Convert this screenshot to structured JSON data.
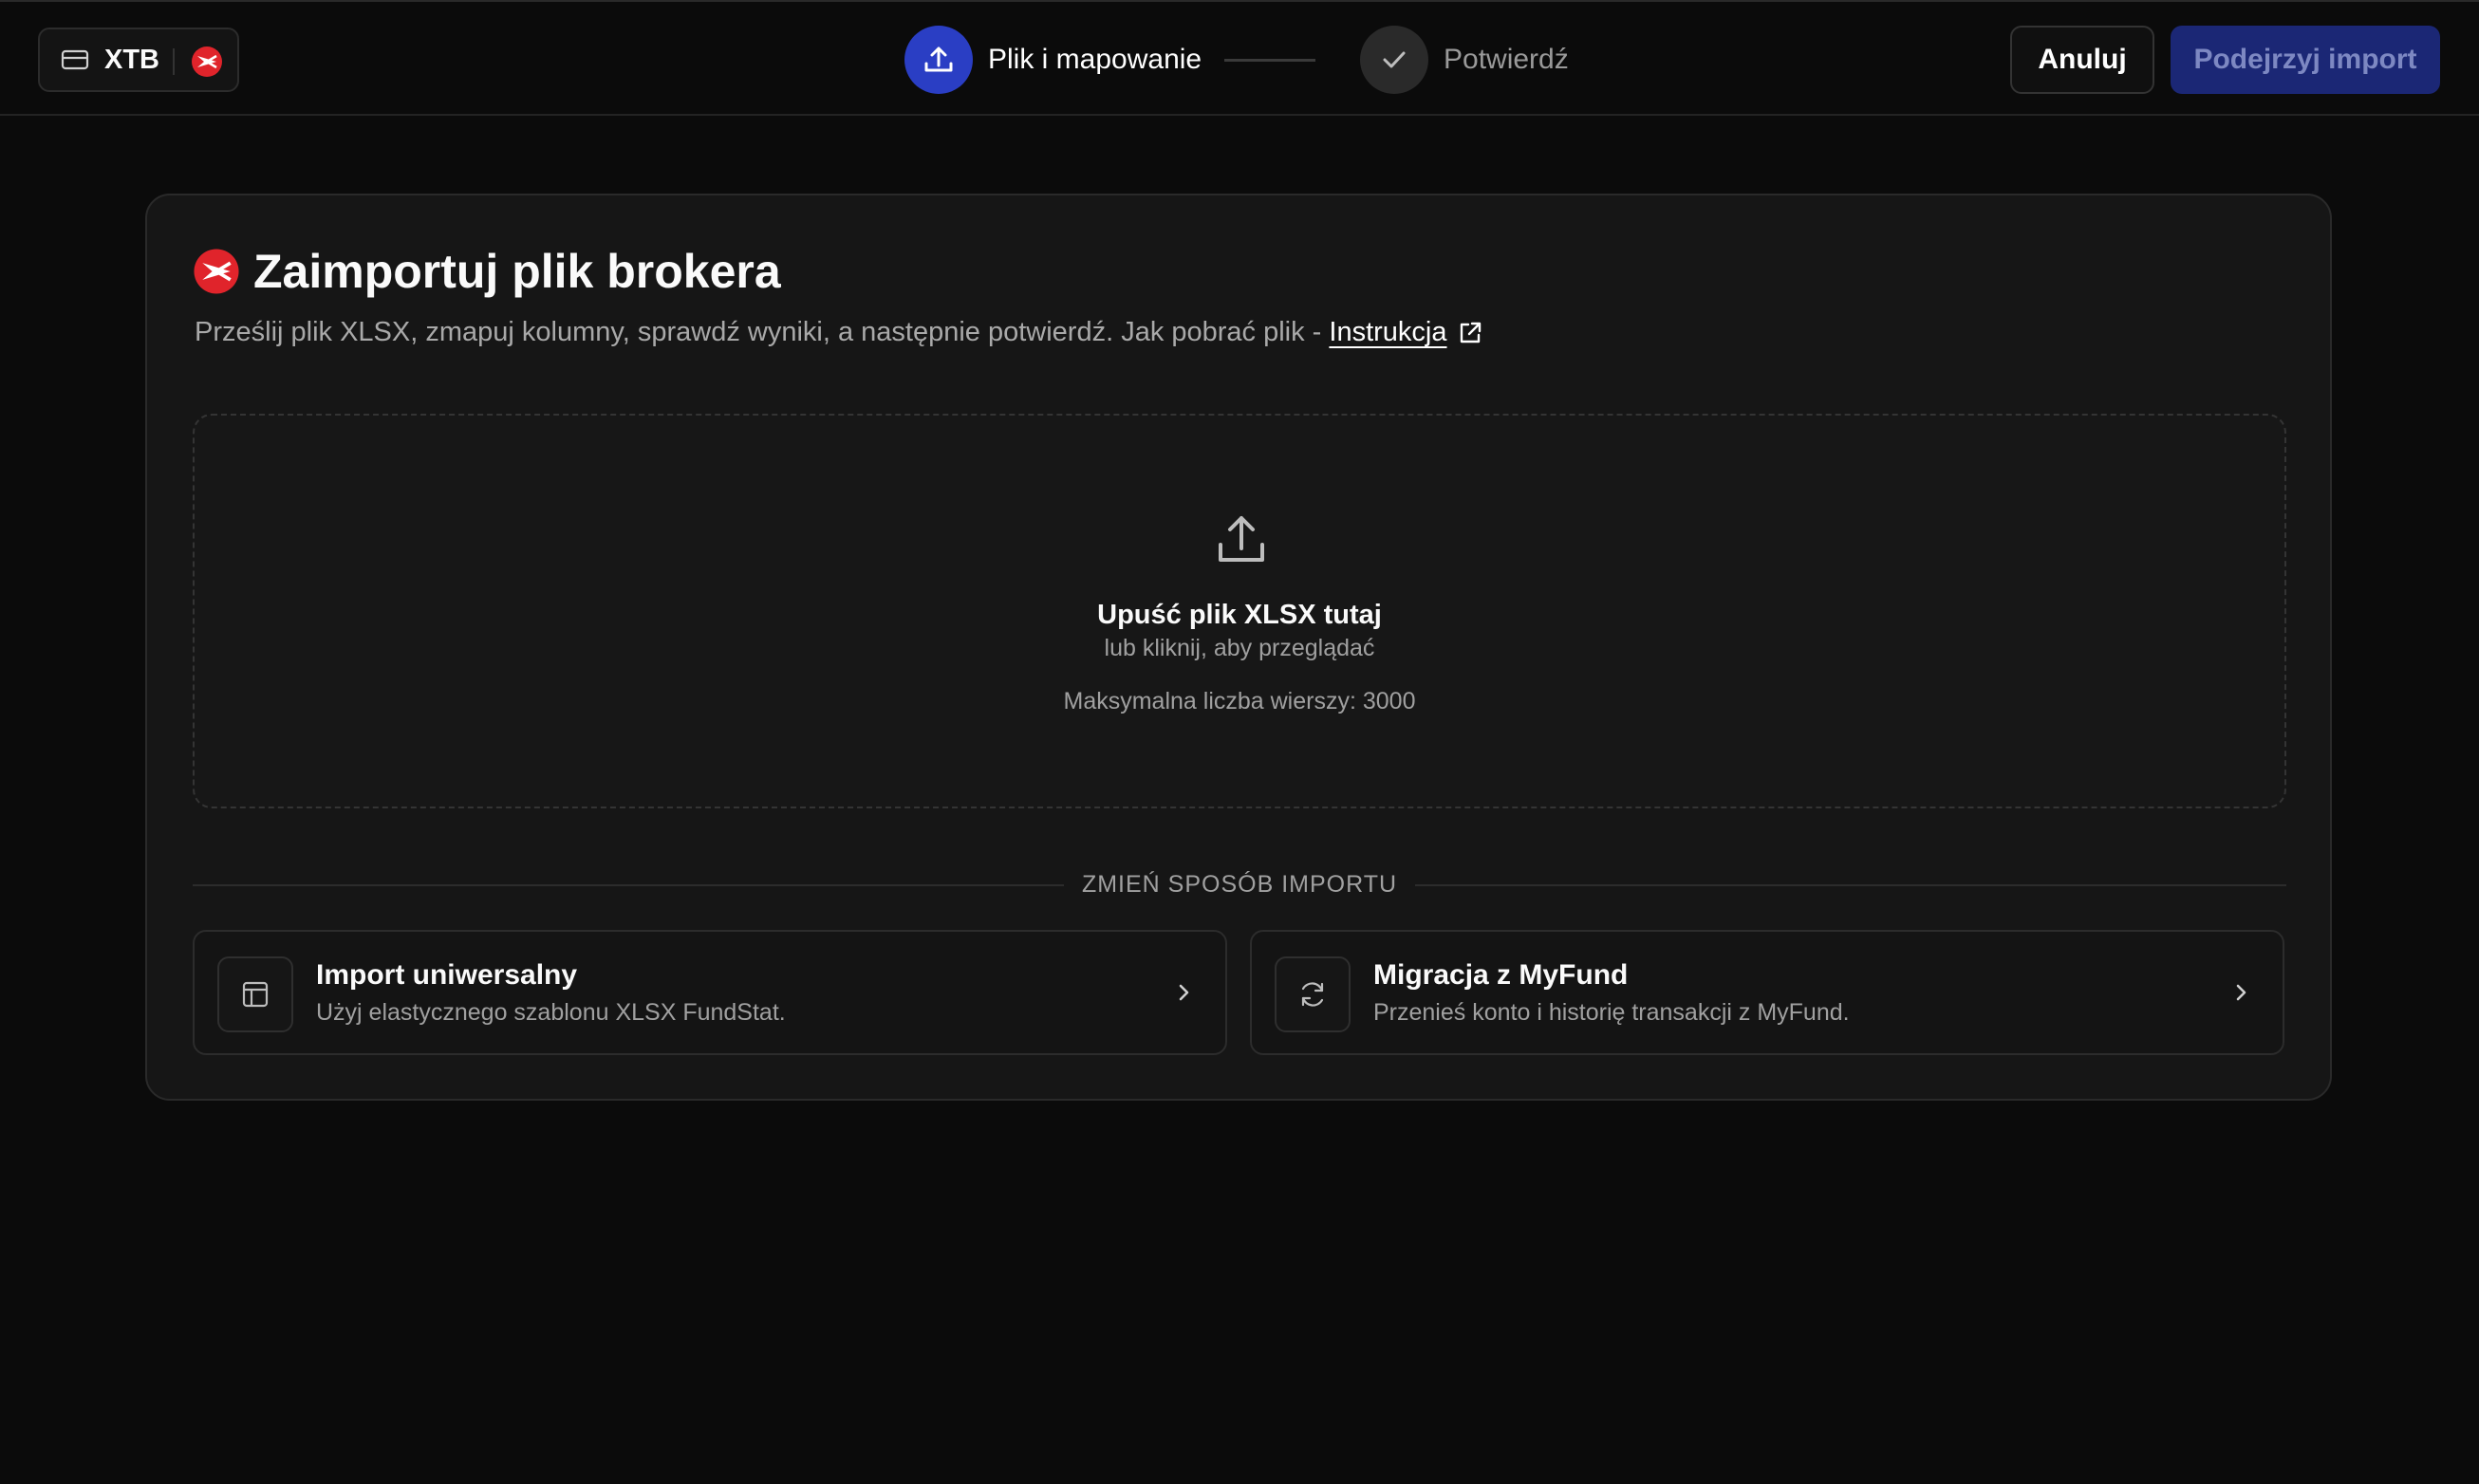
{
  "topbar": {
    "account": {
      "label": "XTB",
      "icon": "credit-card-icon",
      "logo": "xtb-logo"
    },
    "steps": [
      {
        "label": "Plik i mapowanie",
        "icon": "upload-icon",
        "state": "active"
      },
      {
        "label": "Potwierdź",
        "icon": "check-icon",
        "state": "pending"
      }
    ],
    "cancel_label": "Anuluj",
    "preview_label": "Podejrzyj import"
  },
  "card": {
    "title": "Zaimportuj plik brokera",
    "subtitle": "Prześlij plik XLSX, zmapuj kolumny, sprawdź wyniki, a następnie potwierdź. Jak pobrać plik - ",
    "instruction_link": "Instrukcja",
    "dropzone": {
      "title": "Upuść plik XLSX tutaj",
      "subtitle": "lub kliknij, aby przeglądać",
      "max_rows": "Maksymalna liczba wierszy: 3000"
    },
    "divider_label": "ZMIEŃ SPOSÓB IMPORTU",
    "options": [
      {
        "title": "Import uniwersalny",
        "description": "Użyj elastycznego szablonu XLSX FundStat.",
        "icon": "table-icon"
      },
      {
        "title": "Migracja z MyFund",
        "description": "Przenieś konto i historię transakcji z MyFund.",
        "icon": "refresh-icon"
      }
    ]
  },
  "colors": {
    "accent": "#2a3ec4",
    "preview_button": "#1b2775",
    "brand_red": "#e0242b"
  }
}
